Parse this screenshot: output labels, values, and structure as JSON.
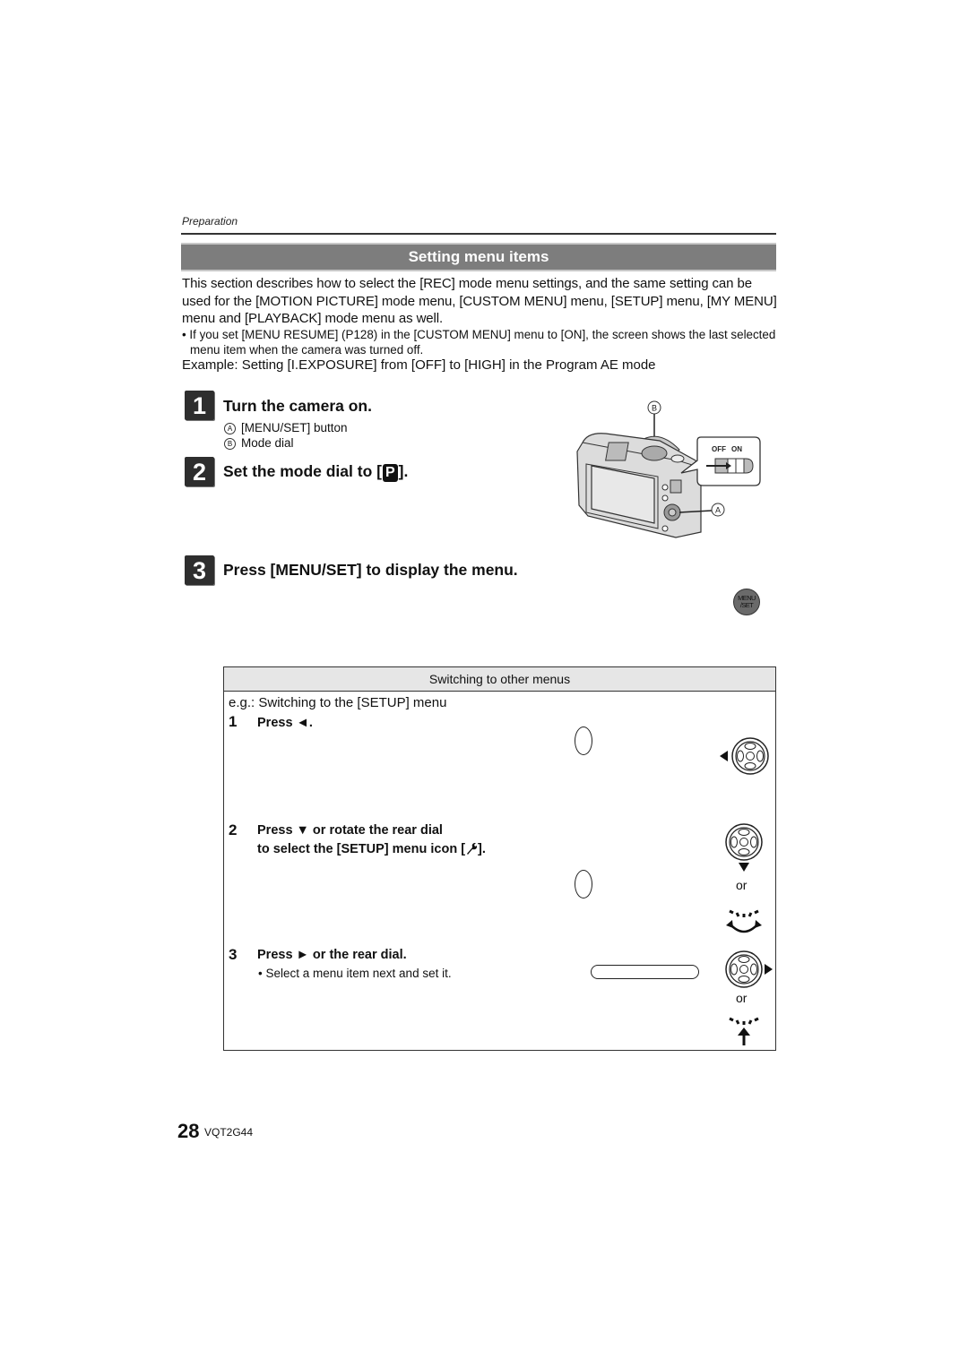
{
  "header": {
    "section": "Preparation",
    "title": "Setting menu items"
  },
  "intro": {
    "paragraph": "This section describes how to select the [REC] mode menu settings, and the same setting can be used for the [MOTION PICTURE] mode menu, [CUSTOM MENU] menu, [SETUP] menu, [MY MENU] menu and [PLAYBACK] mode menu as well.",
    "note": "• If you set [MENU RESUME] (P128) in the [CUSTOM MENU] menu to [ON], the screen shows the last selected menu item when the camera was turned off.",
    "example": "Example: Setting [I.EXPOSURE] from [OFF] to [HIGH] in the Program AE mode"
  },
  "steps": [
    {
      "number": "1",
      "title": "Turn the camera on.",
      "callouts": [
        {
          "marker": "A",
          "text": "[MENU/SET] button"
        },
        {
          "marker": "B",
          "text": "Mode dial"
        }
      ]
    },
    {
      "number": "2",
      "title_prefix": "Set the mode dial to [",
      "mode_icon": "P",
      "title_suffix": "]."
    },
    {
      "number": "3",
      "title": "Press [MENU/SET] to display the menu.",
      "button_icon": "MENU\n/SET"
    }
  ],
  "camera_figure": {
    "label_a": "A",
    "label_b": "B",
    "switch_off": "OFF",
    "switch_on": "ON"
  },
  "menu_button": {
    "line1": "MENU",
    "line2": "/SET"
  },
  "switching_box": {
    "heading": "Switching to other menus",
    "example": "e.g.: Switching to the [SETUP] menu",
    "substeps": [
      {
        "number": "1",
        "text": "Press ◄.",
        "icon": "cursor-left"
      },
      {
        "number": "2",
        "line1": "Press ▼ or rotate the rear dial",
        "line2_prefix": "to select the [SETUP] menu icon [",
        "line2_icon": "wrench",
        "line2_suffix": "].",
        "alt": "or",
        "icon": "cursor-down"
      },
      {
        "number": "3",
        "text": "Press ► or the rear dial.",
        "bullet": "• Select a menu item next and set it.",
        "alt": "or",
        "icon": "cursor-right"
      }
    ]
  },
  "footer": {
    "page_number": "28",
    "doc_code": "VQT2G44"
  }
}
